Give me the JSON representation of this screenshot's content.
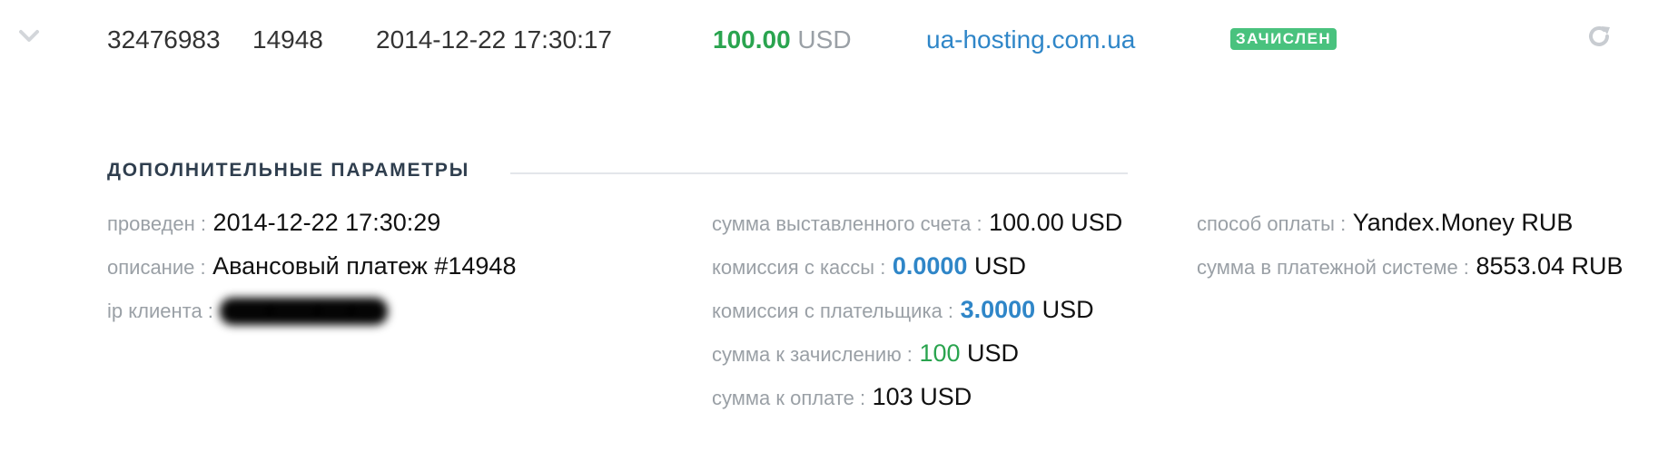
{
  "row": {
    "expand_icon": "chevron-down-icon",
    "transaction_id": "32476983",
    "invoice_id": "14948",
    "datetime": "2014-12-22 17:30:17",
    "amount_value": "100.00",
    "amount_currency": "USD",
    "site": "ua-hosting.com.ua",
    "status_badge": "ЗАЧИСЛЕН",
    "refresh_icon": "refresh-icon",
    "colors": {
      "amount": "#2aa44f",
      "link": "#2f86c8",
      "badge": "#49c27e"
    }
  },
  "details": {
    "title": "ДОПОЛНИТЕЛЬНЫЕ ПАРАМЕТРЫ",
    "col1": {
      "processed_label": "проведен :",
      "processed_value": "2014-12-22 17:30:29",
      "description_label": "описание :",
      "description_value": "Авансовый платеж #14948",
      "ip_label": "ip клиента :",
      "ip_value": "###.###.##.##"
    },
    "col2": {
      "invoice_sum_label": "сумма выставленного счета :",
      "invoice_sum_value": "100.00",
      "invoice_sum_currency": "USD",
      "cashbox_fee_label": "комиссия с кассы :",
      "cashbox_fee_value": "0.0000",
      "cashbox_fee_currency": "USD",
      "payer_fee_label": "комиссия с плательщика :",
      "payer_fee_value": "3.0000",
      "payer_fee_currency": "USD",
      "to_credit_label": "сумма к зачислению :",
      "to_credit_value": "100",
      "to_credit_currency": "USD",
      "to_pay_label": "сумма к оплате :",
      "to_pay_value": "103 USD"
    },
    "col3": {
      "method_label": "способ оплаты :",
      "method_value": "Yandex.Money RUB",
      "system_sum_label": "сумма в платежной системе :",
      "system_sum_value": "8553.04 RUB"
    }
  }
}
